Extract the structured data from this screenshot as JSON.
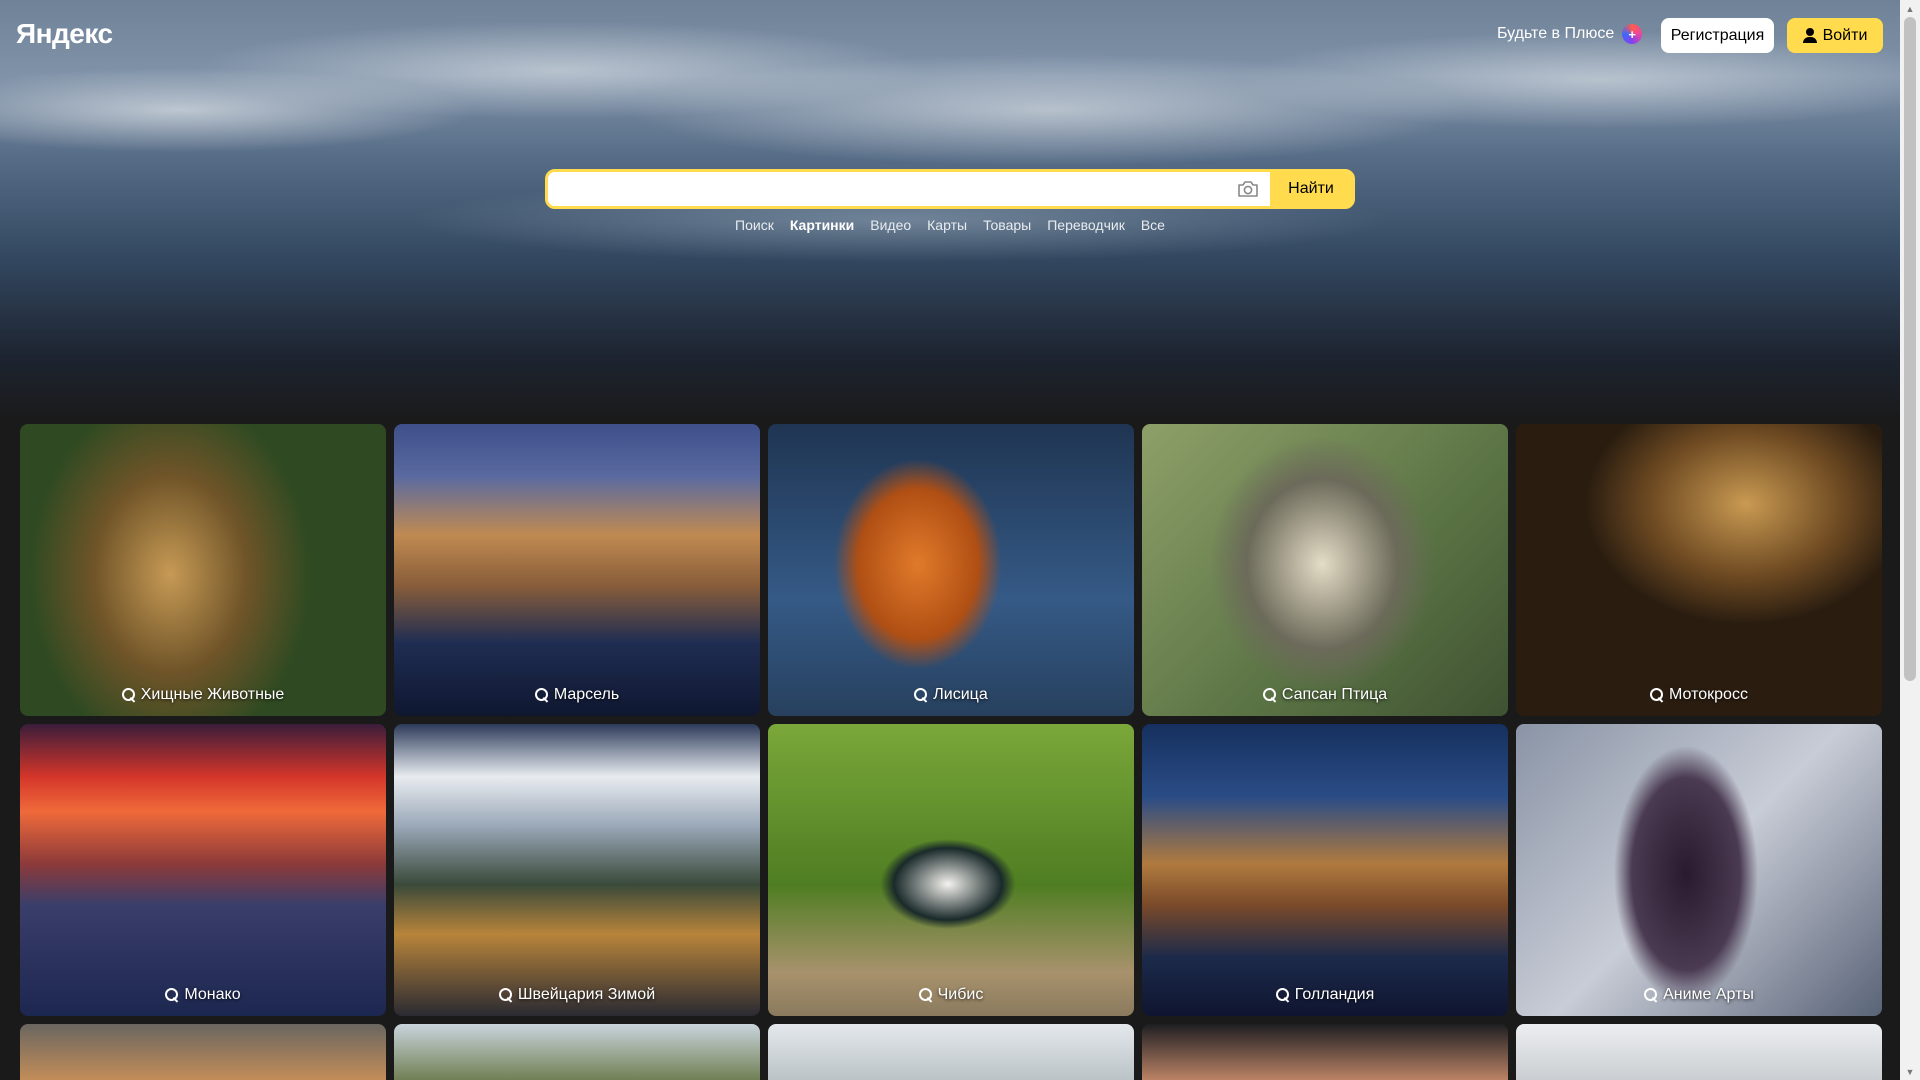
{
  "header": {
    "logo": "Яндекс",
    "plus_promo": "Будьте в Плюсе",
    "plus_icon": "plus-icon",
    "register_label": "Регистрация",
    "login_label": "Войти"
  },
  "search": {
    "value": "",
    "placeholder": "",
    "camera_icon": "camera-icon",
    "submit_label": "Найти"
  },
  "services": [
    {
      "label": "Поиск",
      "active": false
    },
    {
      "label": "Картинки",
      "active": true
    },
    {
      "label": "Видео",
      "active": false
    },
    {
      "label": "Карты",
      "active": false
    },
    {
      "label": "Товары",
      "active": false
    },
    {
      "label": "Переводчик",
      "active": false
    },
    {
      "label": "Все",
      "active": false
    }
  ],
  "tiles": [
    {
      "caption": "Хищные Животные"
    },
    {
      "caption": "Марсель"
    },
    {
      "caption": "Лисица"
    },
    {
      "caption": "Сапсан Птица"
    },
    {
      "caption": "Мотокросс"
    },
    {
      "caption": "Монако"
    },
    {
      "caption": "Швейцария Зимой"
    },
    {
      "caption": "Чибис"
    },
    {
      "caption": "Голландия"
    },
    {
      "caption": "Аниме Арты"
    }
  ],
  "colors": {
    "accent_yellow": "#ffdb4d",
    "page_background": "#1a1a1a"
  }
}
